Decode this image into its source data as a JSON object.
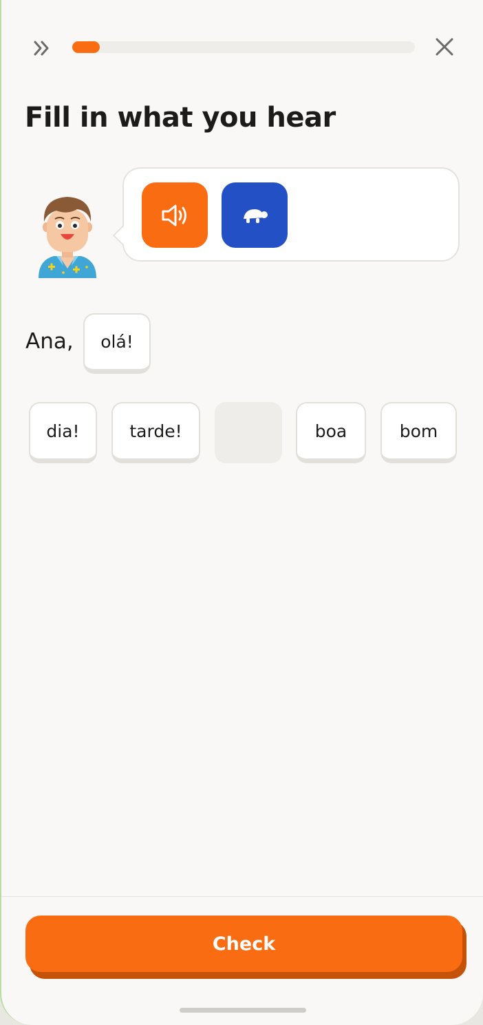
{
  "header": {
    "skip_icon": "double-chevron-right-icon",
    "close_icon": "close-icon",
    "progress": 0.08,
    "progress_color": "#f96c12"
  },
  "title": "Fill in what you hear",
  "audio": {
    "normal_icon": "speaker-icon",
    "slow_icon": "turtle-icon",
    "normal_color": "#f96c12",
    "slow_color": "#2350c4"
  },
  "sentence": {
    "prefix": "Ana,",
    "answer_tile": "olá!"
  },
  "word_bank": {
    "tiles": [
      "dia!",
      "tarde!",
      "boa",
      "bom"
    ],
    "empty_slot": true
  },
  "footer": {
    "check_label": "Check"
  }
}
